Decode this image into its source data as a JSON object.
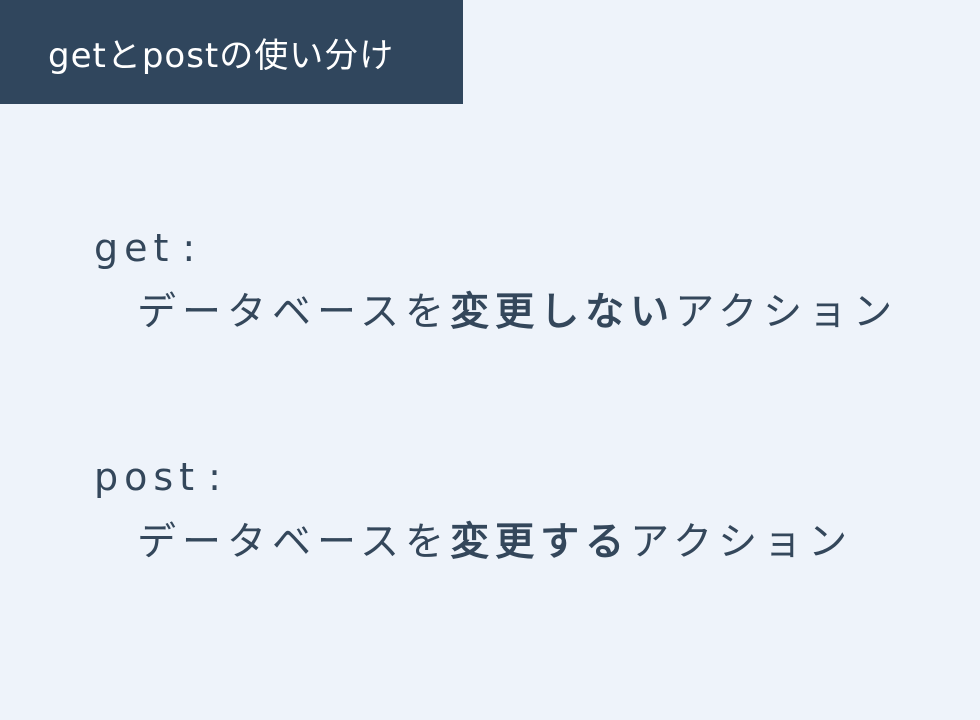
{
  "title": "getとpostの使い分け",
  "sections": [
    {
      "method": "get",
      "separator": ":",
      "description": {
        "prefix": "データベースを",
        "emphasis": "変更しない",
        "suffix": "アクション"
      }
    },
    {
      "method": "post",
      "separator": ":",
      "description": {
        "prefix": "データベースを",
        "emphasis": "変更する",
        "suffix": "アクション"
      }
    }
  ],
  "colors": {
    "background": "#eef3fa",
    "banner": "#30465d",
    "text": "#34475b",
    "banner_text": "#ffffff"
  }
}
